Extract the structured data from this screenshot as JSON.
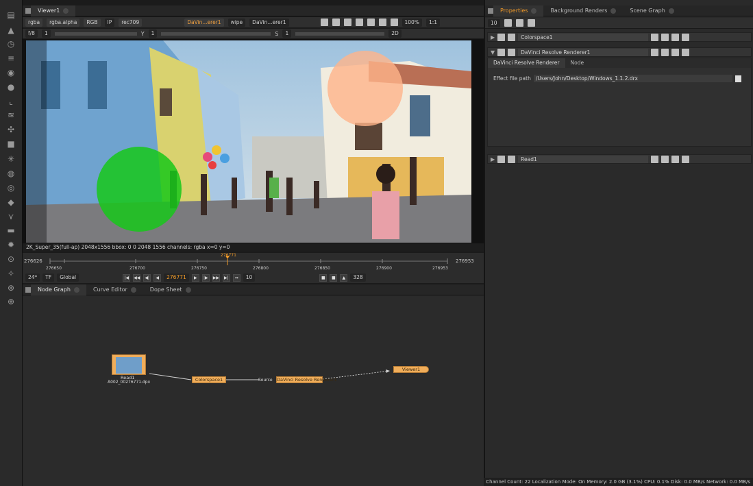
{
  "viewer": {
    "tab": "Viewer1",
    "channels": "rgba",
    "alpha": "rgba.alpha",
    "colorspace_mode": "RGB",
    "ip": "IP",
    "lut": "rec709",
    "input_a": "DaVin...erer1",
    "wipe": "wipe",
    "input_b": "DaVin...erer1",
    "zoom": "100%",
    "ratio": "1:1",
    "fstop": "f/8",
    "frame_step": "1",
    "y_label": "Y",
    "y_value": "1",
    "s_label": "S",
    "s_value": "1",
    "view_mode": "2D",
    "info": "2K_Super_35(full-ap) 2048x1556  bbox: 0 0 2048 1556 channels: rgba  x=0 y=0"
  },
  "timeline": {
    "start": "276626",
    "end": "276953",
    "current": "276771",
    "ticks": [
      "276626",
      "276650",
      "276700",
      "276750",
      "276800",
      "276850",
      "276900",
      "276953"
    ],
    "fps": "24*",
    "tf": "TF",
    "scope": "Global",
    "frame_display": "276771",
    "step": "10",
    "fps_box": "328"
  },
  "bottom_tabs": [
    "Node Graph",
    "Curve Editor",
    "Dope Sheet"
  ],
  "nodes": {
    "read": "Read1",
    "read_file": "A002_00276771.dpx",
    "colorspace": "Colorspace1",
    "resolve": "DaVinci Resolve Renderer1",
    "viewer": "Viewer1",
    "source_label": "Source"
  },
  "properties": {
    "tabs": [
      "Properties",
      "Background Renders",
      "Scene Graph"
    ],
    "max_panels": "10",
    "panel1": "Colorspace1",
    "panel2": "DaVinci Resolve Renderer1",
    "subtabs": [
      "DaVinci Resolve Renderer",
      "Node"
    ],
    "effect_label": "Effect file path",
    "effect_path": "/Users/John/Desktop/Windows_1.1.2.drx",
    "panel3": "Read1"
  },
  "status": "Channel Count: 22  Localization Mode: On  Memory: 2.0 GB (3.1%)  CPU: 0.1%  Disk: 0.0 MB/s  Network: 0.0 MB/s"
}
